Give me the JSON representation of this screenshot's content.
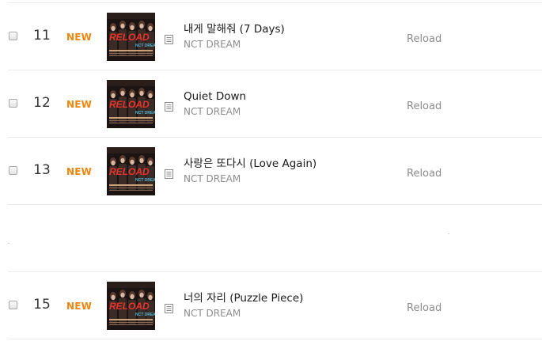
{
  "accent_color": "#f0850b",
  "rows": [
    {
      "rank": "11",
      "badge": "NEW",
      "title": "내게 말해줘 (7 Days)",
      "artist": "NCT DREAM",
      "album": "Reload",
      "album_art": "reload-album-cover",
      "lyrics_icon": "lyrics-icon"
    },
    {
      "rank": "12",
      "badge": "NEW",
      "title": "Quiet Down",
      "artist": "NCT DREAM",
      "album": "Reload",
      "album_art": "reload-album-cover",
      "lyrics_icon": "lyrics-icon"
    },
    {
      "rank": "13",
      "badge": "NEW",
      "title": "사랑은 또다시 (Love Again)",
      "artist": "NCT DREAM",
      "album": "Reload",
      "album_art": "reload-album-cover",
      "lyrics_icon": "lyrics-icon"
    },
    {
      "rank": "15",
      "badge": "NEW",
      "title": "너의 자리 (Puzzle Piece)",
      "artist": "NCT DREAM",
      "album": "Reload",
      "album_art": "reload-album-cover",
      "lyrics_icon": "lyrics-icon"
    }
  ]
}
